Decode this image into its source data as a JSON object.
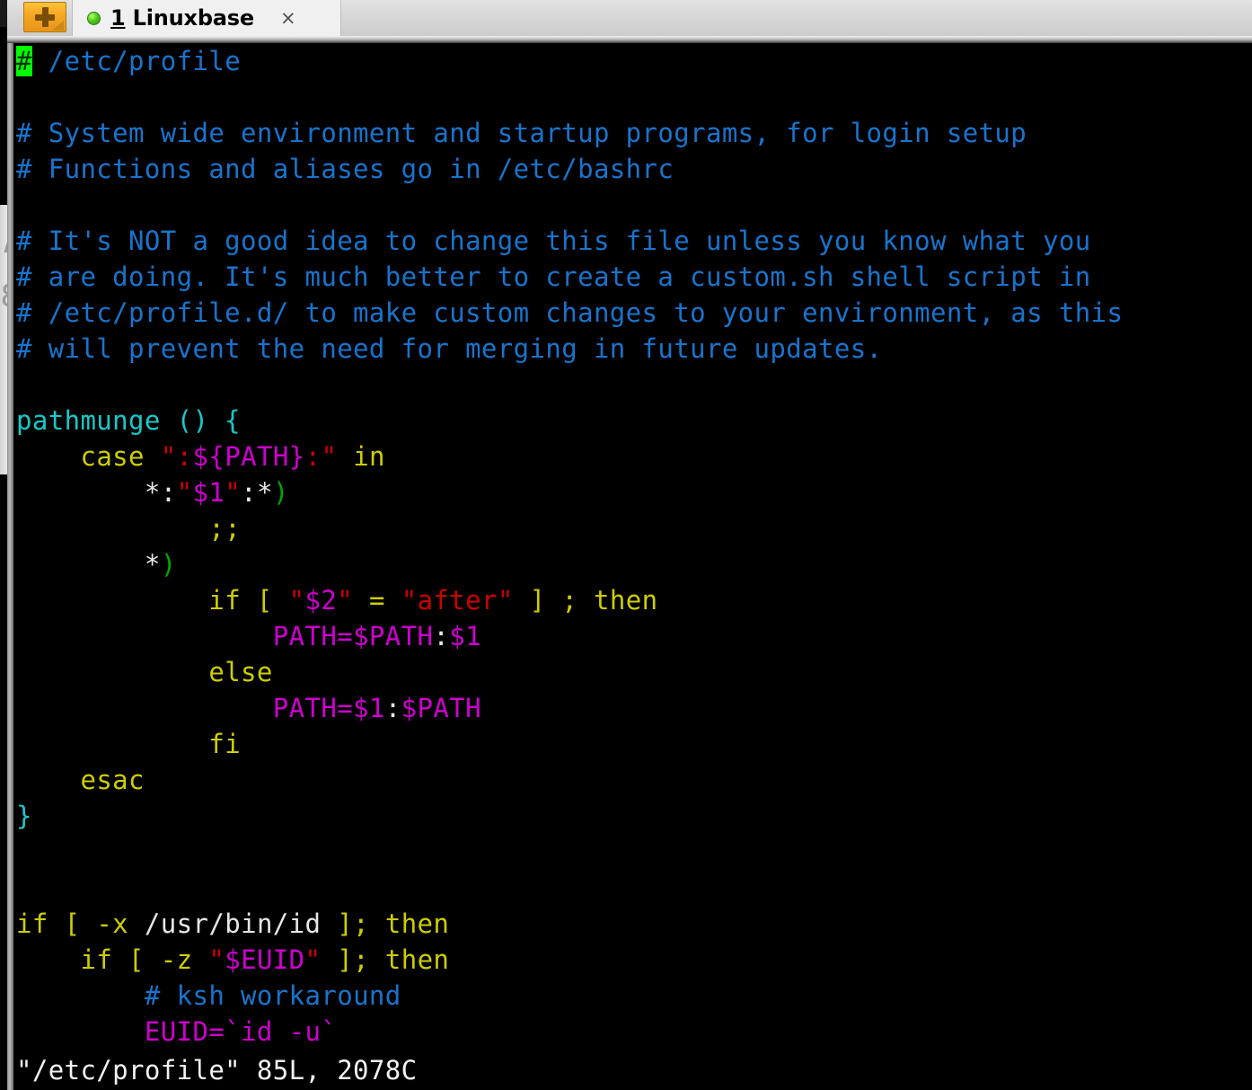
{
  "window": {
    "tabbar": {
      "new_tab_button": {
        "icon": "plus-icon",
        "label": "+"
      },
      "tabs": [
        {
          "led": "green-status-dot",
          "number": "1",
          "title": "Linuxbase",
          "close_label": "×",
          "active": true
        }
      ]
    }
  },
  "terminal": {
    "background": "#000000",
    "cursor": {
      "char": "#",
      "bg_color": "#00ff00",
      "fg_color": "#003000",
      "line": 1,
      "column": 1
    },
    "colors": {
      "comment": "#1874cd",
      "function": "#19c8c8",
      "keyword": "#cdcd00",
      "string": "#cd0000",
      "variable": "#cd00cd",
      "plain": "#e6e6e6",
      "paren": "#00a800"
    },
    "file_name": "/etc/profile",
    "lines": [
      {
        "id": "l1",
        "segments": [
          {
            "t": "#",
            "c": "cursor"
          },
          {
            "t": " /etc/profile",
            "c": "c-comment"
          }
        ]
      },
      {
        "id": "l2",
        "segments": []
      },
      {
        "id": "l3",
        "segments": [
          {
            "t": "# System wide environment and startup programs, for login setup",
            "c": "c-comment"
          }
        ]
      },
      {
        "id": "l4",
        "segments": [
          {
            "t": "# Functions and aliases go in /etc/bashrc",
            "c": "c-comment"
          }
        ]
      },
      {
        "id": "l5",
        "segments": []
      },
      {
        "id": "l6",
        "segments": [
          {
            "t": "# It's NOT a good idea to change this file unless you know what you",
            "c": "c-comment"
          }
        ]
      },
      {
        "id": "l7",
        "segments": [
          {
            "t": "# are doing. It's much better to create a custom.sh shell script in",
            "c": "c-comment"
          }
        ]
      },
      {
        "id": "l8",
        "segments": [
          {
            "t": "# /etc/profile.d/ to make custom changes to your environment, as this",
            "c": "c-comment"
          }
        ]
      },
      {
        "id": "l9",
        "segments": [
          {
            "t": "# will prevent the need for merging in future updates.",
            "c": "c-comment"
          }
        ]
      },
      {
        "id": "l10",
        "segments": []
      },
      {
        "id": "l11",
        "segments": [
          {
            "t": "pathmunge () {",
            "c": "c-fn"
          }
        ]
      },
      {
        "id": "l12",
        "segments": [
          {
            "t": "    ",
            "c": "c-plain"
          },
          {
            "t": "case",
            "c": "c-kw"
          },
          {
            "t": " ",
            "c": "c-plain"
          },
          {
            "t": "\"",
            "c": "c-str"
          },
          {
            "t": ":",
            "c": "c-str"
          },
          {
            "t": "${PATH}",
            "c": "c-var"
          },
          {
            "t": ":",
            "c": "c-str"
          },
          {
            "t": "\"",
            "c": "c-str"
          },
          {
            "t": " ",
            "c": "c-plain"
          },
          {
            "t": "in",
            "c": "c-kw"
          }
        ]
      },
      {
        "id": "l13",
        "segments": [
          {
            "t": "        ",
            "c": "c-plain"
          },
          {
            "t": "*:",
            "c": "c-plain"
          },
          {
            "t": "\"",
            "c": "c-str"
          },
          {
            "t": "$1",
            "c": "c-var"
          },
          {
            "t": "\"",
            "c": "c-str"
          },
          {
            "t": ":*",
            "c": "c-plain"
          },
          {
            "t": ")",
            "c": "c-paren"
          }
        ]
      },
      {
        "id": "l14",
        "segments": [
          {
            "t": "            ",
            "c": "c-plain"
          },
          {
            "t": ";;",
            "c": "c-kw"
          }
        ]
      },
      {
        "id": "l15",
        "segments": [
          {
            "t": "        ",
            "c": "c-plain"
          },
          {
            "t": "*",
            "c": "c-plain"
          },
          {
            "t": ")",
            "c": "c-paren"
          }
        ]
      },
      {
        "id": "l16",
        "segments": [
          {
            "t": "            ",
            "c": "c-plain"
          },
          {
            "t": "if [ ",
            "c": "c-kw"
          },
          {
            "t": "\"",
            "c": "c-str"
          },
          {
            "t": "$2",
            "c": "c-var"
          },
          {
            "t": "\"",
            "c": "c-str"
          },
          {
            "t": " = ",
            "c": "c-kw"
          },
          {
            "t": "\"after\"",
            "c": "c-str"
          },
          {
            "t": " ] ; then",
            "c": "c-kw"
          }
        ]
      },
      {
        "id": "l17",
        "segments": [
          {
            "t": "                ",
            "c": "c-plain"
          },
          {
            "t": "PATH=$PATH",
            "c": "c-var"
          },
          {
            "t": ":",
            "c": "c-plain"
          },
          {
            "t": "$1",
            "c": "c-var"
          }
        ]
      },
      {
        "id": "l18",
        "segments": [
          {
            "t": "            ",
            "c": "c-plain"
          },
          {
            "t": "else",
            "c": "c-kw"
          }
        ]
      },
      {
        "id": "l19",
        "segments": [
          {
            "t": "                ",
            "c": "c-plain"
          },
          {
            "t": "PATH=$1",
            "c": "c-var"
          },
          {
            "t": ":",
            "c": "c-plain"
          },
          {
            "t": "$PATH",
            "c": "c-var"
          }
        ]
      },
      {
        "id": "l20",
        "segments": [
          {
            "t": "            ",
            "c": "c-plain"
          },
          {
            "t": "fi",
            "c": "c-kw"
          }
        ]
      },
      {
        "id": "l21",
        "segments": [
          {
            "t": "    ",
            "c": "c-plain"
          },
          {
            "t": "esac",
            "c": "c-kw"
          }
        ]
      },
      {
        "id": "l22",
        "segments": [
          {
            "t": "}",
            "c": "c-brace"
          }
        ]
      },
      {
        "id": "l23",
        "segments": []
      },
      {
        "id": "l24",
        "segments": []
      },
      {
        "id": "l25",
        "segments": [
          {
            "t": "if [ ",
            "c": "c-kw"
          },
          {
            "t": "-x",
            "c": "c-kw"
          },
          {
            "t": " ",
            "c": "c-plain"
          },
          {
            "t": "/usr/bin/id",
            "c": "c-plain"
          },
          {
            "t": " ]; then",
            "c": "c-kw"
          }
        ]
      },
      {
        "id": "l26",
        "segments": [
          {
            "t": "    ",
            "c": "c-plain"
          },
          {
            "t": "if [ -z ",
            "c": "c-kw"
          },
          {
            "t": "\"",
            "c": "c-str"
          },
          {
            "t": "$EUID",
            "c": "c-var"
          },
          {
            "t": "\"",
            "c": "c-str"
          },
          {
            "t": " ]; then",
            "c": "c-kw"
          }
        ]
      },
      {
        "id": "l27",
        "segments": [
          {
            "t": "        ",
            "c": "c-plain"
          },
          {
            "t": "# ksh workaround",
            "c": "c-comment"
          }
        ]
      },
      {
        "id": "l28",
        "segments": [
          {
            "t": "        ",
            "c": "c-plain"
          },
          {
            "t": "EUID=",
            "c": "c-var"
          },
          {
            "t": "`id -u`",
            "c": "c-var"
          }
        ]
      }
    ],
    "status_line": "\"/etc/profile\" 85L, 2078C"
  }
}
